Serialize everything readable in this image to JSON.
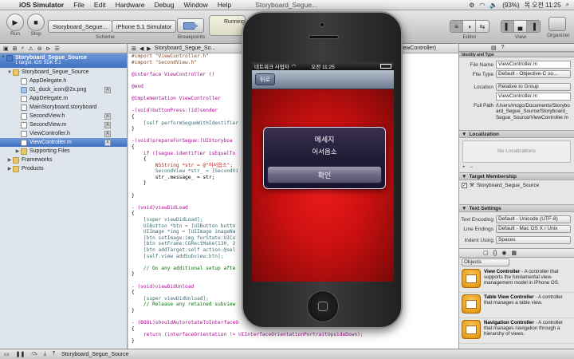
{
  "menubar": {
    "app": "iOS Simulator",
    "items": [
      "File",
      "Edit",
      "Hardware",
      "Debug",
      "Window",
      "Help"
    ],
    "active_file": "Storyboard_Segue...",
    "battery": "(93%)",
    "clock": "목 오전 11:25"
  },
  "toolbar": {
    "run_label": "Run",
    "stop_label": "Stop",
    "scheme_name": "Storyboard_Segue...",
    "scheme_dest": "iPhone 5.1 Simulator",
    "scheme_label": "Scheme",
    "breakpoints_label": "Breakpoints",
    "status": "Running",
    "editor_label": "Editor",
    "view_label": "View",
    "organizer_label": "Organizer"
  },
  "navigator": {
    "project_name": "Storyboard_Segue_Source",
    "project_sub": "1 target, iOS SDK 5.1",
    "files": [
      {
        "name": "Storyboard_Segue_Source",
        "type": "folder",
        "level": 1,
        "badge": ""
      },
      {
        "name": "AppDelegate.h",
        "type": "h",
        "level": 2,
        "badge": ""
      },
      {
        "name": "01_dock_icon@2x.png",
        "type": "img",
        "level": 2,
        "badge": "A"
      },
      {
        "name": "AppDelegate.m",
        "type": "m",
        "level": 2,
        "badge": ""
      },
      {
        "name": "MainStoryboard.storyboard",
        "type": "sb",
        "level": 2,
        "badge": ""
      },
      {
        "name": "SecondView.h",
        "type": "h",
        "level": 2,
        "badge": "A"
      },
      {
        "name": "SecondView.m",
        "type": "m",
        "level": 2,
        "badge": "A"
      },
      {
        "name": "ViewController.h",
        "type": "h",
        "level": 2,
        "badge": "A"
      },
      {
        "name": "ViewController.m",
        "type": "m",
        "level": 2,
        "badge": "A"
      },
      {
        "name": "Supporting Files",
        "type": "folder",
        "level": 2,
        "badge": ""
      },
      {
        "name": "Frameworks",
        "type": "folder",
        "level": 1,
        "badge": ""
      },
      {
        "name": "Products",
        "type": "folder",
        "level": 1,
        "badge": ""
      }
    ]
  },
  "jumpbar": {
    "path": "Storyboard_Segue_So...",
    "trailing": "ViewController)"
  },
  "code": [
    "#import \"ViewController.h\"",
    "#import \"SecondView.h\"",
    "",
    "@interface ViewController ()",
    "",
    "@end",
    "",
    "@implementation ViewController",
    "",
    "-(void)buttonPress:(id)sender",
    "{",
    "    [self performSegueWithIdentifier",
    "}",
    "",
    "-(void)prepareForSegue:(UIStoryboa",
    "{",
    "    if ([segue.identifier isEqualTo",
    "    {",
    "        NSString *str = @\"어서옵소\";",
    "        SecondView *str_ = [SecondVi",
    "        str_.message_ = str;",
    "    }",
    "",
    "}",
    "",
    "- (void)viewDidLoad",
    "{",
    "    [super viewDidLoad];",
    "    UIButton *btn = [UIButton butto",
    "    UIImage *img = [UIImage imageNa",
    "    [btn setImage:img forState:UICo",
    "    [btn setFrame:CGRectMake(130, 2",
    "    [btn addTarget:self action:@sel                    TouchUpInside];",
    "    [self.view addSubview:btn];",
    "",
    "    // Do any additional setup afte",
    "}",
    "",
    "- (void)viewDidUnload",
    "{",
    "    [super viewDidUnload];",
    "    // Release any retained subview",
    "}",
    "",
    "- (BOOL)shouldAutorotateToInterfaceO                                 ation",
    "{",
    "    return (interfaceOrientation != UIInterfaceOrientationPortraitUpsideDown);",
    "}"
  ],
  "utility": {
    "identity_header": "Identity and Type",
    "file_name_label": "File Name",
    "file_name": "ViewController.m",
    "file_type_label": "File Type",
    "file_type": "Default - Objective-C so...",
    "location_label": "Location",
    "location": "Relative to Group",
    "location_file": "ViewController.m",
    "full_path_label": "Full Path",
    "full_path": "/Users/mogo/Documents/Storyboard_Segue_Source/Storyboard_Segue_Source/ViewController.m",
    "localization_header": "Localization",
    "no_localizations": "No Localizations",
    "target_header": "Target Membership",
    "target_name": "Storyboard_Segue_Source",
    "text_settings_header": "Text Settings",
    "text_encoding_label": "Text Encoding",
    "text_encoding": "Default - Unicode (UTF-8)",
    "line_endings_label": "Line Endings",
    "line_endings": "Default - Mac OS X / Unix",
    "indent_label": "Indent Using",
    "indent": "Spaces",
    "library_filter": "Objects",
    "library": [
      {
        "title": "View Controller",
        "desc": " - A controller that supports the fundamental view-management model in iPhone OS."
      },
      {
        "title": "Table View Controller",
        "desc": " - A controller that manages a table view."
      },
      {
        "title": "Navigation Controller",
        "desc": " - A controller that manages navigation through a hierarchy of views."
      }
    ]
  },
  "debugbar": {
    "target": "Storyboard_Segue_Source"
  },
  "simulator": {
    "carrier": "네트워크 사업자",
    "time": "오전 11:25",
    "back_label": "뒤로",
    "alert_title": "메세지",
    "alert_message": "어서옵소",
    "alert_button": "확인"
  }
}
